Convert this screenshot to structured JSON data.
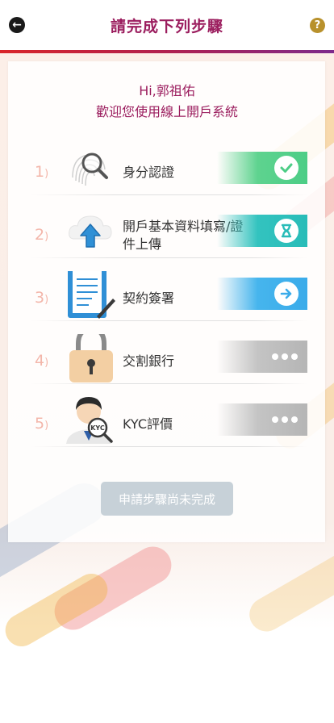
{
  "header": {
    "title": "請完成下列步驟",
    "back_icon": "arrow-left-icon",
    "help_icon": "question-mark-icon",
    "accent_color": "#9b1d5e"
  },
  "greeting": {
    "line1": "Hi,郭祖佑",
    "line2": "歡迎您使用線上開戶系統"
  },
  "steps": [
    {
      "num": "1",
      "label": "身分認證",
      "icon": "fingerprint-magnifier-icon",
      "status": "completed",
      "status_icon": "check-icon",
      "color": "#58cf8c"
    },
    {
      "num": "2",
      "label": "開戶基本資料填寫/證件上傳",
      "icon": "cloud-upload-icon",
      "status": "in-progress",
      "status_icon": "hourglass-icon",
      "color": "#2fc0bc"
    },
    {
      "num": "3",
      "label": "契約簽署",
      "icon": "contract-clipboard-icon",
      "status": "next",
      "status_icon": "arrow-right-icon",
      "color": "#3fb0eb"
    },
    {
      "num": "4",
      "label": "交割銀行",
      "icon": "padlock-icon",
      "status": "pending",
      "status_icon": "dots-icon",
      "color": "#bdbdbd"
    },
    {
      "num": "5",
      "label": "KYC評價",
      "icon": "kyc-person-icon",
      "status": "pending",
      "status_icon": "dots-icon",
      "color": "#bdbdbd"
    }
  ],
  "submit": {
    "label": "申請步驟尚未完成"
  }
}
